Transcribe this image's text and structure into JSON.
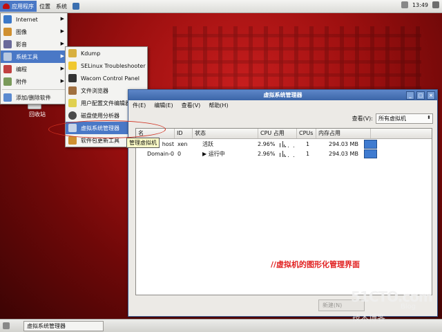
{
  "top_panel": {
    "menus": [
      "应用程序",
      "位置",
      "系统"
    ],
    "clock": "13:49"
  },
  "app_menu": {
    "items": [
      {
        "label": "Internet",
        "submenu": true
      },
      {
        "label": "图像",
        "submenu": true
      },
      {
        "label": "影音",
        "submenu": true
      },
      {
        "label": "系统工具",
        "submenu": true,
        "highlighted": true
      },
      {
        "label": "编程",
        "submenu": true
      },
      {
        "label": "附件",
        "submenu": true
      },
      {
        "label": "添加/删除软件",
        "submenu": false
      }
    ]
  },
  "system_tools_menu": {
    "items": [
      {
        "label": "Kdump"
      },
      {
        "label": "SELinux Troubleshooter"
      },
      {
        "label": "Wacom Control Panel"
      },
      {
        "label": "文件浏览器"
      },
      {
        "label": "用户配置文件编辑器"
      },
      {
        "label": "磁盘使用分析器"
      },
      {
        "label": "虚拟系统管理器",
        "highlighted": true
      },
      {
        "label": "软件包更新工具"
      }
    ]
  },
  "tooltip": "管理虚拟机",
  "desktop": {
    "recycle_bin_label": "回收站"
  },
  "window": {
    "title": "虚拟系统管理器",
    "menubar": [
      "件(E)",
      "编辑(E)",
      "查看(V)",
      "帮助(H)"
    ],
    "view_label": "查看(V):",
    "view_selected": "所有虚拟机",
    "columns": [
      "名",
      "ID",
      "状态",
      "CPU 占用",
      "CPUs",
      "内存占用"
    ],
    "rows": [
      {
        "name": "host",
        "id": "xen",
        "state": "活跃",
        "cpu": "2.96%",
        "cpus": "1",
        "mem": "294.03 MB"
      },
      {
        "name": "Domain-0",
        "id": "0",
        "state": "运行中",
        "cpu": "2.96%",
        "cpus": "1",
        "mem": "294.03 MB"
      }
    ],
    "bottom_button": "新建(N)"
  },
  "annotation": "//虚拟机的图形化管理界面",
  "taskbar": {
    "task": "虚拟系统管理器"
  },
  "watermark": {
    "site": "51CTO.com",
    "sub": "技术博客",
    "blog": "Blog"
  }
}
